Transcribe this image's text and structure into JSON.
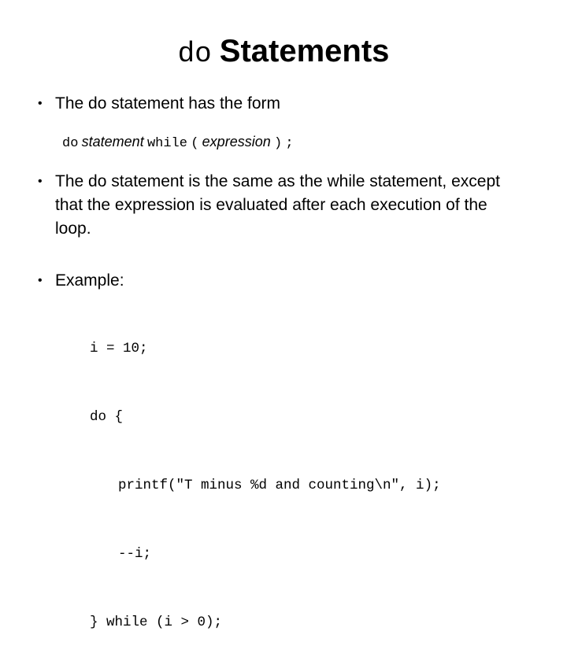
{
  "title": {
    "code_part": "do",
    "text_part": "Statements"
  },
  "bullets": [
    {
      "symbol": "•",
      "text": "The do statement has the form"
    },
    {
      "symbol": "•",
      "text": "The do statement is the same as the while statement, except that the expression is evaluated after each execution of the loop."
    },
    {
      "symbol": "•",
      "text": "Example:"
    }
  ],
  "syntax_form": {
    "kw_do": "do",
    "statement": "statement",
    "kw_while": "while",
    "open_paren": "(",
    "expression": "expression",
    "close_paren": ")",
    "semicolon": ";"
  },
  "example_code": [
    "i = 10;",
    "do {",
    "printf(\"T minus %d and counting\\n\", i);",
    "--i;",
    "} while (i > 0);"
  ]
}
